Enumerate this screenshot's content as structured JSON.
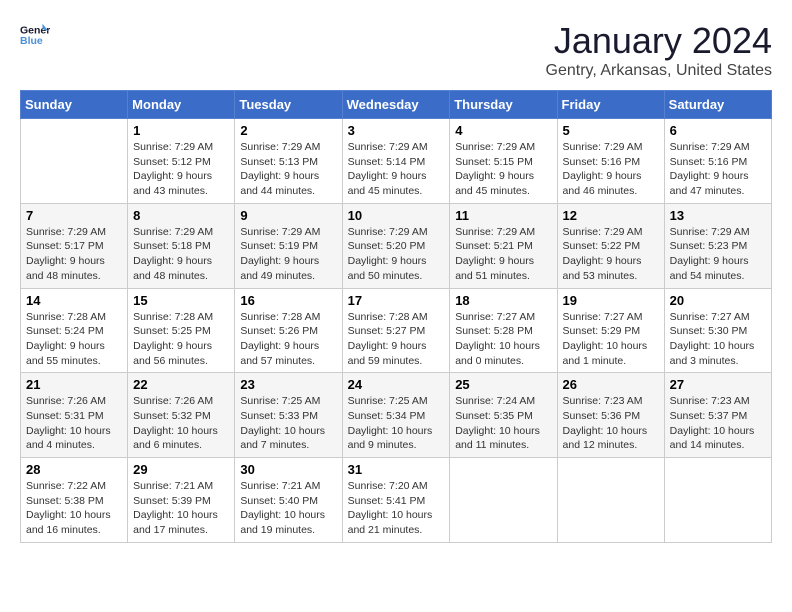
{
  "header": {
    "logo_line1": "General",
    "logo_line2": "Blue",
    "month": "January 2024",
    "location": "Gentry, Arkansas, United States"
  },
  "weekdays": [
    "Sunday",
    "Monday",
    "Tuesday",
    "Wednesday",
    "Thursday",
    "Friday",
    "Saturday"
  ],
  "weeks": [
    [
      {
        "day": "",
        "info": ""
      },
      {
        "day": "1",
        "info": "Sunrise: 7:29 AM\nSunset: 5:12 PM\nDaylight: 9 hours\nand 43 minutes."
      },
      {
        "day": "2",
        "info": "Sunrise: 7:29 AM\nSunset: 5:13 PM\nDaylight: 9 hours\nand 44 minutes."
      },
      {
        "day": "3",
        "info": "Sunrise: 7:29 AM\nSunset: 5:14 PM\nDaylight: 9 hours\nand 45 minutes."
      },
      {
        "day": "4",
        "info": "Sunrise: 7:29 AM\nSunset: 5:15 PM\nDaylight: 9 hours\nand 45 minutes."
      },
      {
        "day": "5",
        "info": "Sunrise: 7:29 AM\nSunset: 5:16 PM\nDaylight: 9 hours\nand 46 minutes."
      },
      {
        "day": "6",
        "info": "Sunrise: 7:29 AM\nSunset: 5:16 PM\nDaylight: 9 hours\nand 47 minutes."
      }
    ],
    [
      {
        "day": "7",
        "info": "Sunrise: 7:29 AM\nSunset: 5:17 PM\nDaylight: 9 hours\nand 48 minutes."
      },
      {
        "day": "8",
        "info": "Sunrise: 7:29 AM\nSunset: 5:18 PM\nDaylight: 9 hours\nand 48 minutes."
      },
      {
        "day": "9",
        "info": "Sunrise: 7:29 AM\nSunset: 5:19 PM\nDaylight: 9 hours\nand 49 minutes."
      },
      {
        "day": "10",
        "info": "Sunrise: 7:29 AM\nSunset: 5:20 PM\nDaylight: 9 hours\nand 50 minutes."
      },
      {
        "day": "11",
        "info": "Sunrise: 7:29 AM\nSunset: 5:21 PM\nDaylight: 9 hours\nand 51 minutes."
      },
      {
        "day": "12",
        "info": "Sunrise: 7:29 AM\nSunset: 5:22 PM\nDaylight: 9 hours\nand 53 minutes."
      },
      {
        "day": "13",
        "info": "Sunrise: 7:29 AM\nSunset: 5:23 PM\nDaylight: 9 hours\nand 54 minutes."
      }
    ],
    [
      {
        "day": "14",
        "info": "Sunrise: 7:28 AM\nSunset: 5:24 PM\nDaylight: 9 hours\nand 55 minutes."
      },
      {
        "day": "15",
        "info": "Sunrise: 7:28 AM\nSunset: 5:25 PM\nDaylight: 9 hours\nand 56 minutes."
      },
      {
        "day": "16",
        "info": "Sunrise: 7:28 AM\nSunset: 5:26 PM\nDaylight: 9 hours\nand 57 minutes."
      },
      {
        "day": "17",
        "info": "Sunrise: 7:28 AM\nSunset: 5:27 PM\nDaylight: 9 hours\nand 59 minutes."
      },
      {
        "day": "18",
        "info": "Sunrise: 7:27 AM\nSunset: 5:28 PM\nDaylight: 10 hours\nand 0 minutes."
      },
      {
        "day": "19",
        "info": "Sunrise: 7:27 AM\nSunset: 5:29 PM\nDaylight: 10 hours\nand 1 minute."
      },
      {
        "day": "20",
        "info": "Sunrise: 7:27 AM\nSunset: 5:30 PM\nDaylight: 10 hours\nand 3 minutes."
      }
    ],
    [
      {
        "day": "21",
        "info": "Sunrise: 7:26 AM\nSunset: 5:31 PM\nDaylight: 10 hours\nand 4 minutes."
      },
      {
        "day": "22",
        "info": "Sunrise: 7:26 AM\nSunset: 5:32 PM\nDaylight: 10 hours\nand 6 minutes."
      },
      {
        "day": "23",
        "info": "Sunrise: 7:25 AM\nSunset: 5:33 PM\nDaylight: 10 hours\nand 7 minutes."
      },
      {
        "day": "24",
        "info": "Sunrise: 7:25 AM\nSunset: 5:34 PM\nDaylight: 10 hours\nand 9 minutes."
      },
      {
        "day": "25",
        "info": "Sunrise: 7:24 AM\nSunset: 5:35 PM\nDaylight: 10 hours\nand 11 minutes."
      },
      {
        "day": "26",
        "info": "Sunrise: 7:23 AM\nSunset: 5:36 PM\nDaylight: 10 hours\nand 12 minutes."
      },
      {
        "day": "27",
        "info": "Sunrise: 7:23 AM\nSunset: 5:37 PM\nDaylight: 10 hours\nand 14 minutes."
      }
    ],
    [
      {
        "day": "28",
        "info": "Sunrise: 7:22 AM\nSunset: 5:38 PM\nDaylight: 10 hours\nand 16 minutes."
      },
      {
        "day": "29",
        "info": "Sunrise: 7:21 AM\nSunset: 5:39 PM\nDaylight: 10 hours\nand 17 minutes."
      },
      {
        "day": "30",
        "info": "Sunrise: 7:21 AM\nSunset: 5:40 PM\nDaylight: 10 hours\nand 19 minutes."
      },
      {
        "day": "31",
        "info": "Sunrise: 7:20 AM\nSunset: 5:41 PM\nDaylight: 10 hours\nand 21 minutes."
      },
      {
        "day": "",
        "info": ""
      },
      {
        "day": "",
        "info": ""
      },
      {
        "day": "",
        "info": ""
      }
    ]
  ]
}
